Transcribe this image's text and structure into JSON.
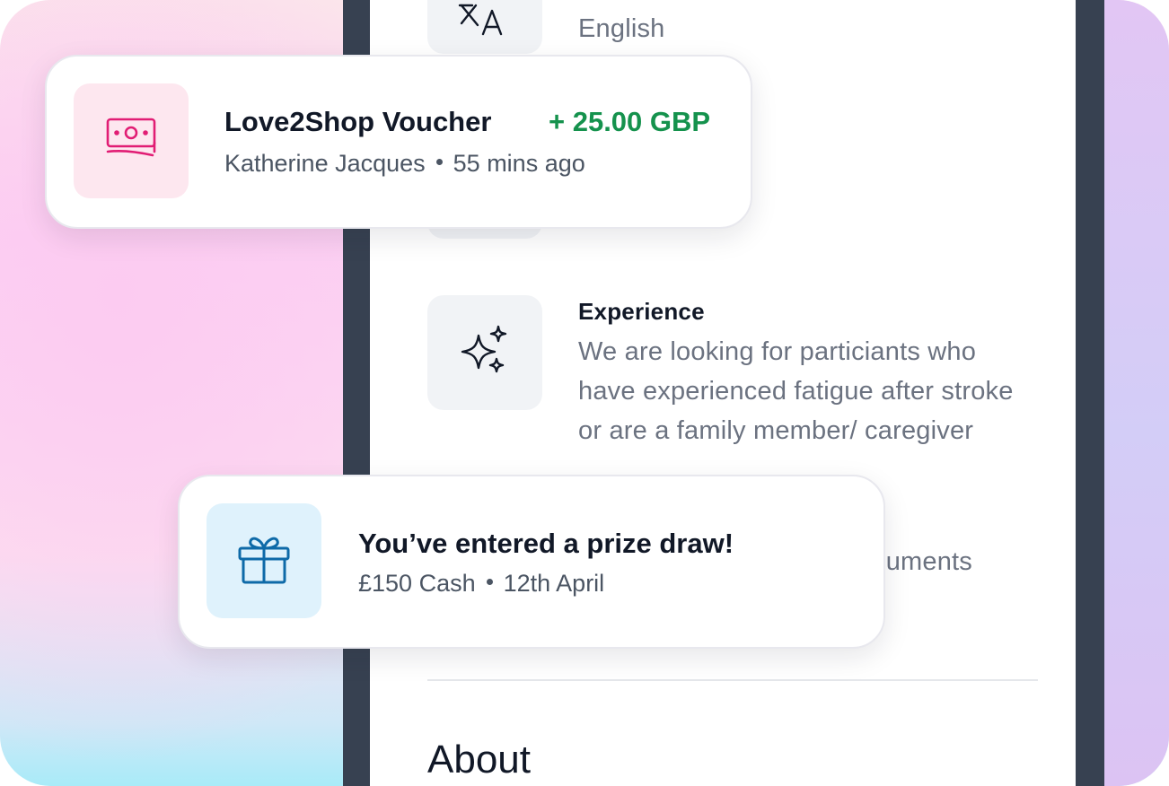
{
  "language": {
    "value": "English",
    "icon": "translate-icon"
  },
  "experience": {
    "title": "Experience",
    "description_lines": [
      "We are looking for particiants who",
      "have experienced fatigue after stroke",
      "or are a family member/ caregiver"
    ],
    "icon": "sparkles-icon"
  },
  "documents": {
    "partial_text": "cuments"
  },
  "about": {
    "heading": "About"
  },
  "voucher_notification": {
    "title": "Love2Shop Voucher",
    "amount": "+ 25.00 GBP",
    "sender": "Katherine Jacques",
    "time": "55 mins ago",
    "icon": "banknote-icon",
    "icon_color": "#e11d74",
    "icon_bg": "#fde7ef",
    "amount_color": "#15924d"
  },
  "prize_notification": {
    "title": "You’ve entered a prize draw!",
    "prize": "£150 Cash",
    "date": "12th April",
    "icon": "gift-icon",
    "icon_color": "#0e6aa8",
    "icon_bg": "#dff2fc"
  }
}
